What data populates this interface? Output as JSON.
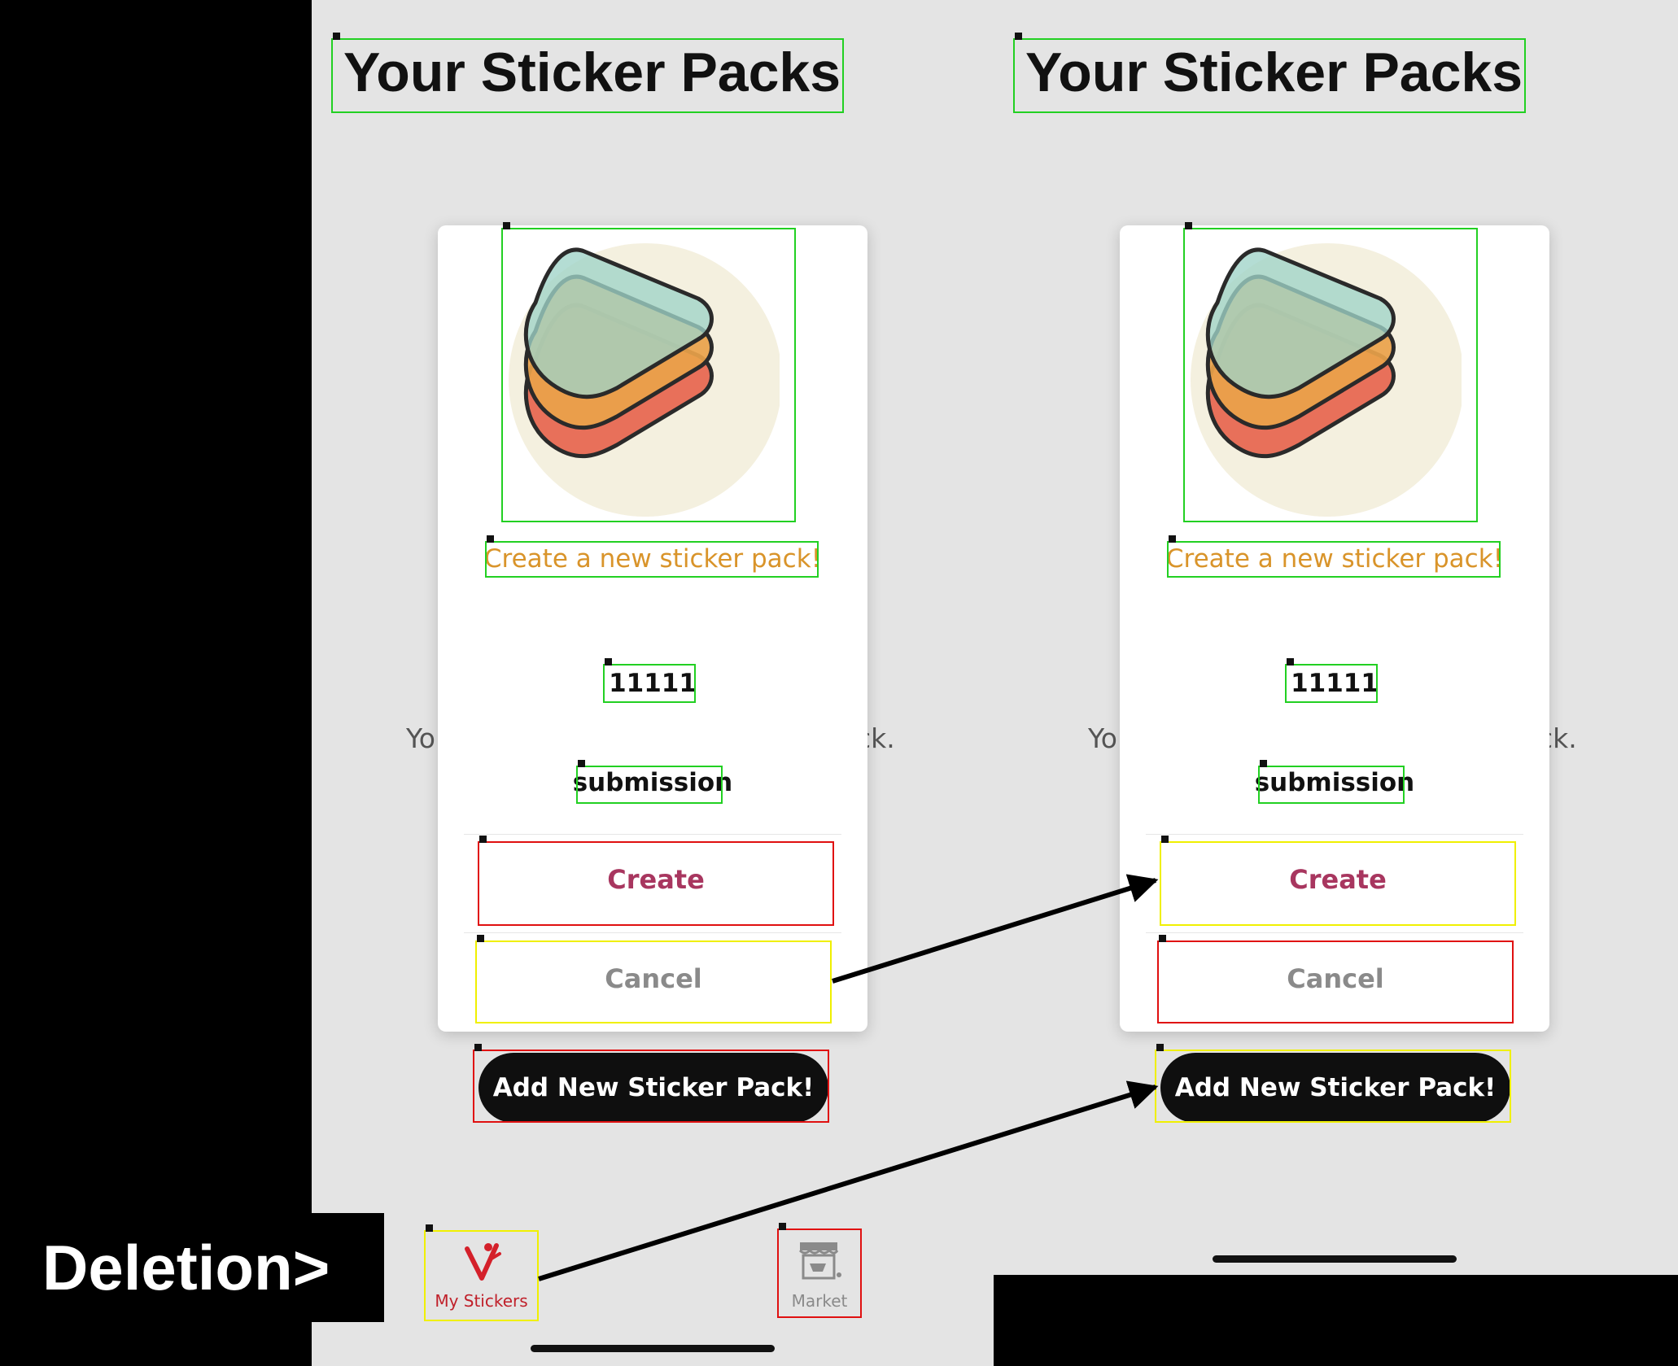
{
  "page_title": "Your Sticker Packs",
  "background_text_left": "Yo",
  "background_text_right": "ck.",
  "modal": {
    "subtitle": "Create a new sticker pack!",
    "name_value": "11111",
    "category_value": "submission",
    "create_label": "Create",
    "cancel_label": "Cancel"
  },
  "add_button_label": "Add New Sticker Pack!",
  "tabbar": {
    "my_stickers_label": "My Stickers",
    "market_label": "Market"
  },
  "annotation_label": "Deletion>",
  "colors": {
    "screen_background": "#e4e4e4",
    "subtitle": "#d9942a",
    "create": "#a8365f",
    "cancel": "#8a8a8a",
    "box_green": "#22d022",
    "box_red": "#e01010",
    "box_yellow": "#f0f000"
  }
}
